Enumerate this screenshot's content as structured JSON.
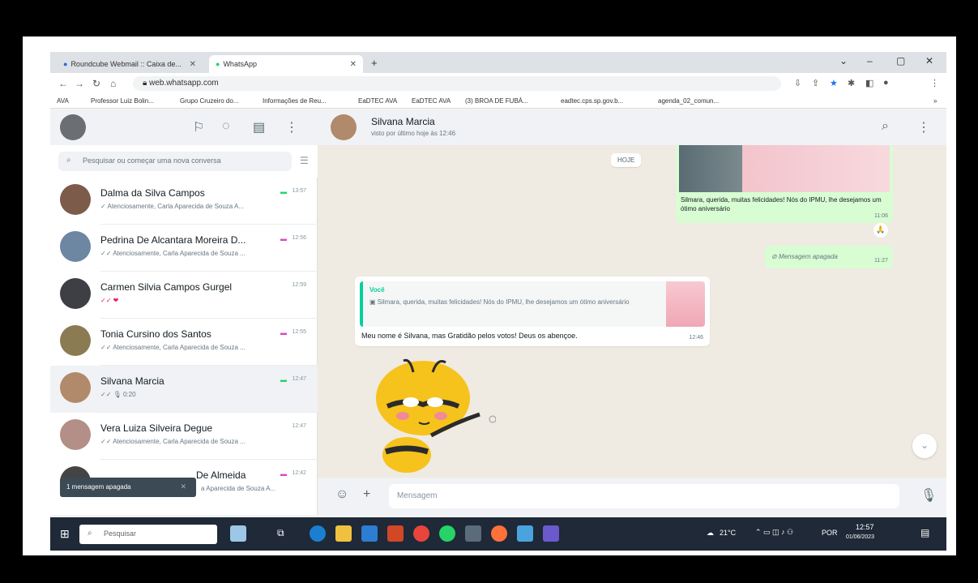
{
  "browser": {
    "tabs": [
      {
        "title": "Roundcube Webmail :: Caixa de..."
      },
      {
        "title": "WhatsApp"
      }
    ],
    "url": "web.whatsapp.com",
    "bookmarks": [
      "AVA",
      "Professor Luiz Bolin...",
      "Grupo Cruzeiro do...",
      "Informações de Reu...",
      "EaDTEC AVA",
      "EaDTEC AVA",
      "(3) BROA DE FUBÁ...",
      "eadtec.cps.sp.gov.b...",
      "agenda_02_comun..."
    ]
  },
  "sidebar": {
    "search_placeholder": "Pesquisar ou começar uma nova conversa",
    "chats": [
      {
        "name": "Dalma da Silva Campos",
        "time": "13:57",
        "preview": "✓ Atenciosamente, Carla Aparecida de Souza A...",
        "pin_color": "green"
      },
      {
        "name": "Pedrina De Alcantara Moreira D...",
        "time": "12:56",
        "preview": "✓✓ Atenciosamente, Carla Aparecida de Souza ...",
        "pin_color": "pink"
      },
      {
        "name": "Carmen Silvia Campos Gurgel",
        "time": "12:59",
        "preview": "✓✓ ❤",
        "pin_color": ""
      },
      {
        "name": "Tonia Cursino dos Santos",
        "time": "12:55",
        "preview": "✓✓ Atenciosamente, Carla Aparecida de Souza ...",
        "pin_color": "pink"
      },
      {
        "name": "Silvana Marcia",
        "time": "12:47",
        "preview": "✓✓ 🎙 0:20",
        "pin_color": "green"
      },
      {
        "name": "Vera Luiza Silveira Degue",
        "time": "12:47",
        "preview": "✓✓ Atenciosamente, Carla Aparecida de Souza ...",
        "pin_color": ""
      },
      {
        "name": "De Almeida",
        "time": "12:42",
        "preview": "a Aparecida de Souza A...",
        "pin_color": "pink"
      }
    ],
    "toast": "1 mensagem apagada"
  },
  "conversation": {
    "contact_name": "Silvana Marcia",
    "status": "visto por último hoje às 12:46",
    "date_chip": "HOJE",
    "outgoing_image_caption": "Silmara, querida, muitas felicidades! Nós do IPMU, lhe desejamos um ótimo aniversário",
    "outgoing_image_time": "11:06",
    "deleted_text": "Mensagem apagada",
    "deleted_time": "11:27",
    "incoming": {
      "quote_author": "Você",
      "quote_text": "Silmara, querida, muitas felicidades! Nós do IPMU, lhe desejamos um ótimo aniversário",
      "text": "Meu nome é Silvana, mas Gratidão pelos votos! Deus os abençoe.",
      "time": "12:46"
    },
    "composer_placeholder": "Mensagem"
  },
  "taskbar": {
    "search_placeholder": "Pesquisar",
    "weather": "21°C",
    "lang": "POR",
    "time": "12:57",
    "date": "01/06/2023"
  },
  "colors": {
    "accent_green": "#25d366",
    "bubble_out": "#d9fdd3",
    "chat_bg": "#efeae2"
  }
}
